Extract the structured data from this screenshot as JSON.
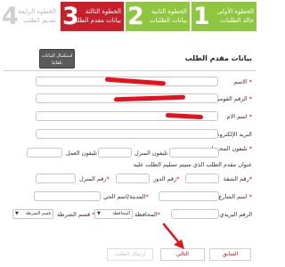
{
  "steps": [
    {
      "num": "1",
      "line1": "الخطوة الأولى",
      "line2": "حالة الطلبات"
    },
    {
      "num": "2",
      "line1": "الخطوة الثانية",
      "line2": "بيانات الطلبات"
    },
    {
      "num": "3",
      "line1": "الخطوة الثالثة",
      "line2": "بيانات مقدم الطلب"
    },
    {
      "num": "4",
      "line1": "الخطوة الرابعة",
      "line2": "تقديم الطلب"
    }
  ],
  "section": {
    "title": "بيانات مقدم الطلب",
    "autofill_label": "استكمال البيانات تلقائيا"
  },
  "form": {
    "name": "الاسم",
    "national_id": "الرقم القومي",
    "mother_name": "اسم الام",
    "email": "البريد الإلكتروني",
    "mobile": "تليفون المحمول",
    "home_phone": "تليفون المنزل",
    "work_phone": "تليفون العمل",
    "delivery_note": "عنوان مقدم الطلب الذي سيتم تسليم الطلب عليه",
    "apartment": "رقم الشقة",
    "floor": "رقم الدور",
    "building": "رقم المنزل",
    "street": "اسم الشارع",
    "city": "المدينة/اسم الحي",
    "postal": "الرقم البريدي",
    "governorate": "المحافظة",
    "governorate_value": "المحافظة",
    "police": "قسم الشرطة",
    "police_value": "قسم الشرطة",
    "required_mark": "*"
  },
  "buttons": {
    "prev": "السابق",
    "next": "التالي",
    "send": "إرسال الطلب"
  },
  "colors": {
    "step_done": "#8ec63f",
    "step_active": "#c8202a",
    "required": "#d0021b"
  }
}
